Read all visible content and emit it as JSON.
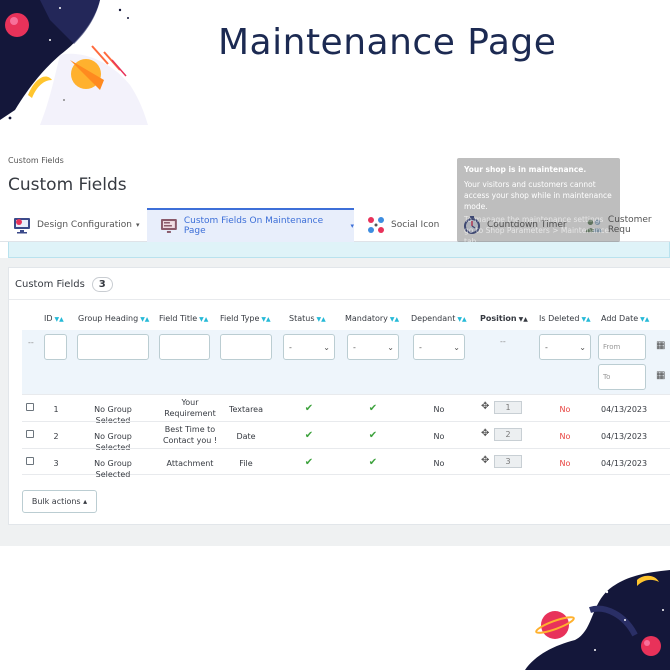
{
  "hero": {
    "title": "Maintenance Page"
  },
  "breadcrumb": "Custom Fields",
  "page_title": "Custom Fields",
  "tabs": [
    {
      "label": "Design Configuration",
      "icon": "design-monitor-icon",
      "has_caret": true
    },
    {
      "label": "Custom Fields On Maintenance Page",
      "icon": "custom-fields-monitor-icon",
      "has_caret": true
    },
    {
      "label": "Social Icon",
      "icon": "social-share-icon",
      "has_caret": false
    },
    {
      "label": "Countdown Timer",
      "icon": "stopwatch-icon",
      "has_caret": false
    },
    {
      "label": "Customer Requ",
      "icon": "customers-icon",
      "has_caret": false
    }
  ],
  "tooltip": {
    "title": "Your shop is in maintenance.",
    "body": "Your visitors and customers cannot access your shop while in maintenance mode.",
    "tail": "To manage the maintenance settings go to Shop Parameters > Maintenance tab."
  },
  "panel": {
    "title": "Custom Fields",
    "count": "3",
    "columns": [
      "ID",
      "Group Heading",
      "Field Title",
      "Field Type",
      "Status",
      "Mandatory",
      "Dependant",
      "Position",
      "Is Deleted",
      "Add Date"
    ],
    "filters": {
      "dash": "--",
      "select_placeholder": "-",
      "position_dash": "--",
      "date_from": "From",
      "date_to": "To"
    },
    "rows": [
      {
        "id": "1",
        "group": "No Group Selected",
        "title_l1": "Your",
        "title_l2": "Requirement",
        "type": "Textarea",
        "status": "✔",
        "mandatory": "✔",
        "dependant": "No",
        "position": "1",
        "deleted": "No",
        "date": "04/13/2023"
      },
      {
        "id": "2",
        "group": "No Group Selected",
        "title_l1": "Best Time to",
        "title_l2": "Contact you !",
        "type": "Date",
        "status": "✔",
        "mandatory": "✔",
        "dependant": "No",
        "position": "2",
        "deleted": "No",
        "date": "04/13/2023"
      },
      {
        "id": "3",
        "group": "No Group Selected",
        "title_l1": "Attachment",
        "title_l2": "",
        "type": "File",
        "status": "✔",
        "mandatory": "✔",
        "dependant": "No",
        "position": "3",
        "deleted": "No",
        "date": "04/13/2023"
      }
    ],
    "bulk_label": "Bulk actions ▴"
  },
  "colors": {
    "hero_navy": "#1c2a52",
    "accent_blue": "#3d6fd8",
    "sort_cyan": "#25b9d7",
    "success_green": "#3fa33f",
    "danger_red": "#e8423f",
    "planet_pink": "#e8325a"
  }
}
